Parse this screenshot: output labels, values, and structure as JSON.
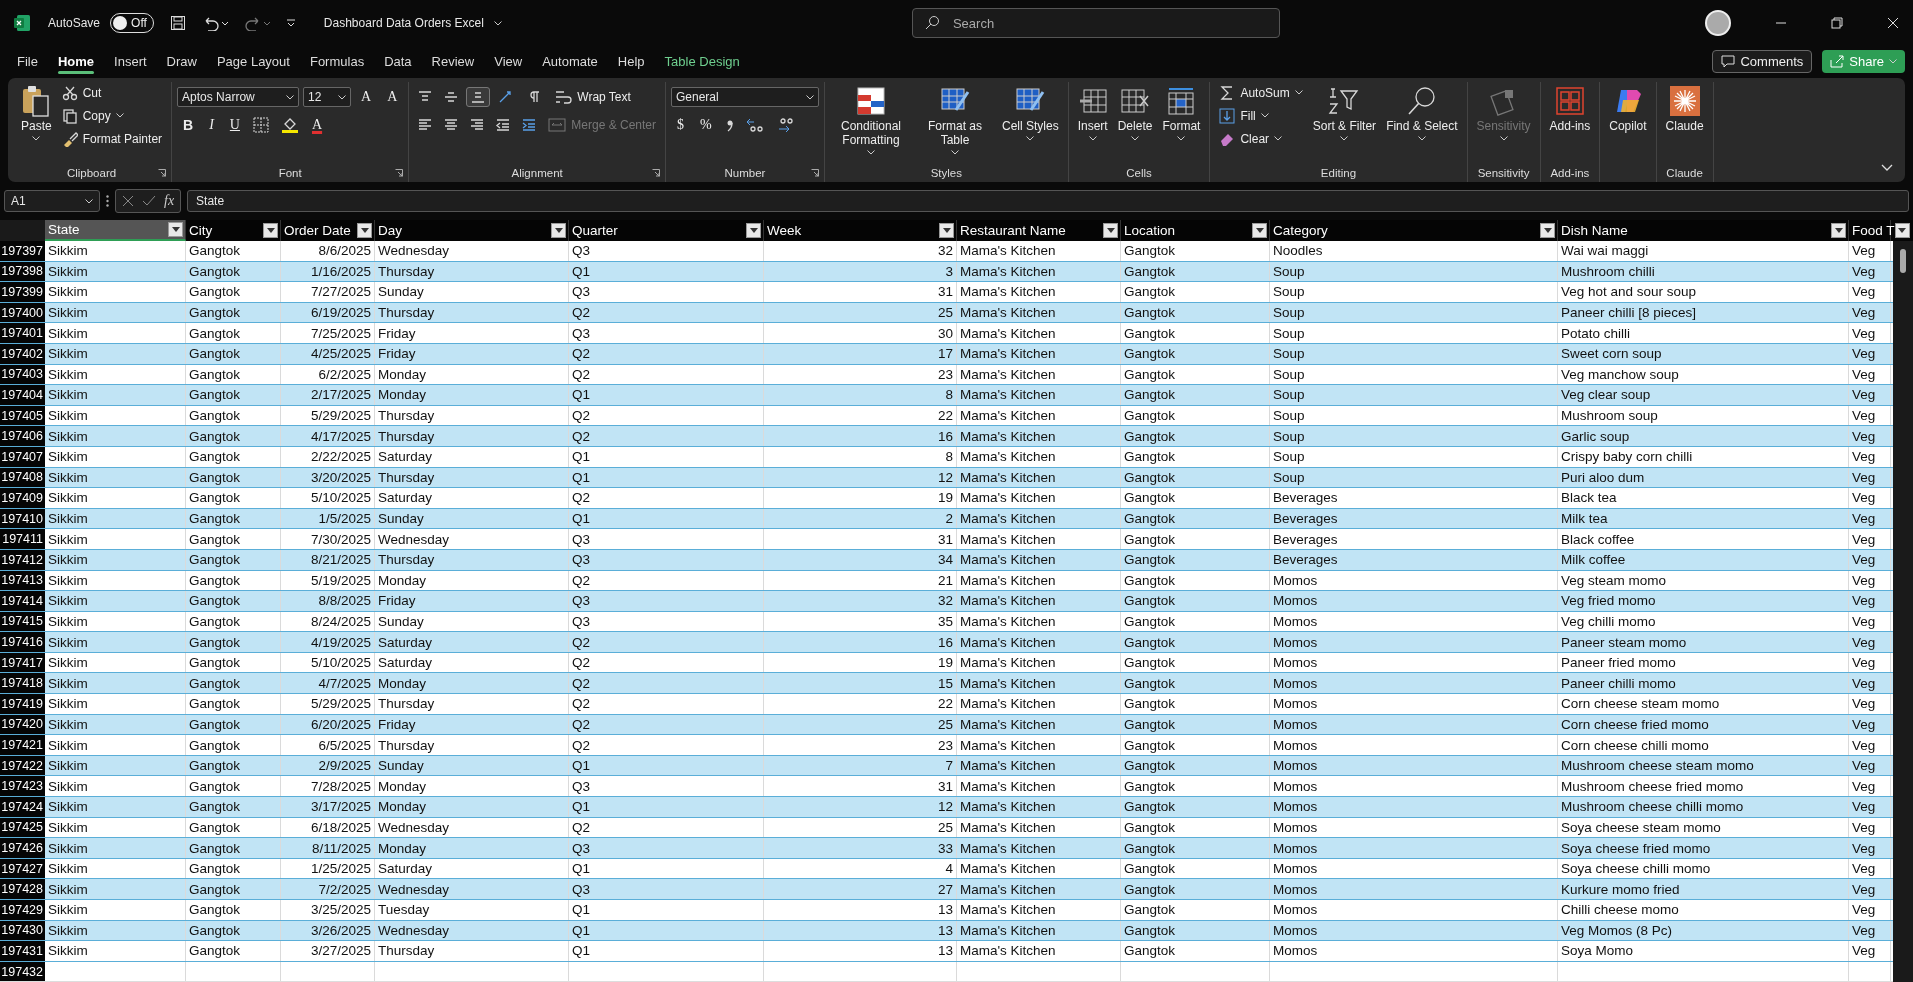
{
  "titlebar": {
    "autosave": {
      "label": "AutoSave",
      "on": false,
      "state_label": "Off"
    },
    "title": "Dashboard Data Orders Excel",
    "search": {
      "placeholder": "Search"
    }
  },
  "menu": {
    "tabs": [
      {
        "label": "File",
        "selected": false,
        "kind": "normal"
      },
      {
        "label": "Home",
        "selected": true,
        "kind": "normal"
      },
      {
        "label": "Insert",
        "selected": false,
        "kind": "normal"
      },
      {
        "label": "Draw",
        "selected": false,
        "kind": "normal"
      },
      {
        "label": "Page Layout",
        "selected": false,
        "kind": "normal"
      },
      {
        "label": "Formulas",
        "selected": false,
        "kind": "normal"
      },
      {
        "label": "Data",
        "selected": false,
        "kind": "normal"
      },
      {
        "label": "Review",
        "selected": false,
        "kind": "normal"
      },
      {
        "label": "View",
        "selected": false,
        "kind": "normal"
      },
      {
        "label": "Automate",
        "selected": false,
        "kind": "normal"
      },
      {
        "label": "Help",
        "selected": false,
        "kind": "normal"
      },
      {
        "label": "Table Design",
        "selected": false,
        "kind": "contextual"
      }
    ],
    "comments": "Comments",
    "share": "Share"
  },
  "ribbon": {
    "groups": [
      {
        "label": "Clipboard",
        "launcher": true,
        "items": [
          {
            "kind": "large",
            "label": "Paste",
            "caret": true,
            "disabled": false
          },
          {
            "kind": "small",
            "label": "Cut",
            "caret": false,
            "disabled": false
          },
          {
            "kind": "small",
            "label": "Copy",
            "caret": true,
            "disabled": false
          },
          {
            "kind": "small",
            "label": "Format Painter",
            "caret": false,
            "disabled": false
          }
        ]
      },
      {
        "label": "Font",
        "launcher": true,
        "top": [
          {
            "kind": "select",
            "value": "Aptos Narrow"
          },
          {
            "kind": "select",
            "value": "12"
          },
          {
            "kind": "glyph",
            "label": "A"
          },
          {
            "kind": "glyph",
            "label": "A"
          }
        ],
        "bottom": [
          {
            "kind": "glyph",
            "label": "B"
          },
          {
            "kind": "glyph",
            "label": "I"
          },
          {
            "kind": "glyph",
            "label": "U"
          },
          {
            "kind": "tool"
          },
          {
            "kind": "tool"
          },
          {
            "kind": "glyph",
            "label": "A"
          }
        ]
      },
      {
        "label": "Alignment",
        "launcher": true,
        "top": [
          {
            "kind": "tool"
          },
          {
            "kind": "tool"
          },
          {
            "kind": "tool"
          },
          {
            "kind": "tool"
          },
          {
            "kind": "tool"
          },
          {
            "kind": "small",
            "label": "Wrap Text",
            "disabled": false
          }
        ],
        "bottom": [
          {
            "kind": "tool"
          },
          {
            "kind": "tool"
          },
          {
            "kind": "tool"
          },
          {
            "kind": "tool"
          },
          {
            "kind": "tool"
          },
          {
            "kind": "small",
            "label": "Merge & Center",
            "disabled": true
          }
        ]
      },
      {
        "label": "Number",
        "launcher": true,
        "top": [
          {
            "kind": "select",
            "value": "General"
          }
        ],
        "bottom": [
          {
            "kind": "glyph",
            "label": "$"
          },
          {
            "kind": "glyph",
            "label": "%"
          },
          {
            "kind": "tool"
          },
          {
            "kind": "tool"
          },
          {
            "kind": "tool"
          }
        ]
      },
      {
        "label": "Styles",
        "launcher": false,
        "items": [
          {
            "kind": "large",
            "label": "Conditional Formatting",
            "caret": true,
            "disabled": false
          },
          {
            "kind": "large",
            "label": "Format as Table",
            "caret": true,
            "disabled": false
          },
          {
            "kind": "large",
            "label": "Cell Styles",
            "caret": true,
            "disabled": false
          }
        ]
      },
      {
        "label": "Cells",
        "launcher": false,
        "items": [
          {
            "kind": "large",
            "label": "Insert",
            "caret": true,
            "disabled": false
          },
          {
            "kind": "large",
            "label": "Delete",
            "caret": true,
            "disabled": false
          },
          {
            "kind": "large",
            "label": "Format",
            "caret": true,
            "disabled": false
          }
        ]
      },
      {
        "label": "Editing",
        "launcher": false,
        "items": [
          {
            "kind": "small",
            "label": "AutoSum",
            "caret": true,
            "disabled": false
          },
          {
            "kind": "small",
            "label": "Fill",
            "caret": true,
            "disabled": false
          },
          {
            "kind": "small",
            "label": "Clear",
            "caret": true,
            "disabled": false
          },
          {
            "kind": "large",
            "label": "Sort & Filter",
            "caret": true,
            "disabled": false
          },
          {
            "kind": "large",
            "label": "Find & Select",
            "caret": true,
            "disabled": false
          }
        ]
      },
      {
        "label": "Sensitivity",
        "launcher": false,
        "items": [
          {
            "kind": "large",
            "label": "Sensitivity",
            "caret": true,
            "disabled": true
          }
        ]
      },
      {
        "label": "Add-ins",
        "launcher": false,
        "items": [
          {
            "kind": "large",
            "label": "Add-ins",
            "caret": false,
            "disabled": false
          }
        ]
      },
      {
        "items": [
          {
            "kind": "large",
            "label": "Copilot",
            "caret": false,
            "disabled": false
          }
        ]
      },
      {
        "label": "Claude",
        "launcher": false,
        "items": [
          {
            "kind": "large",
            "label": "Claude",
            "caret": false,
            "disabled": false
          }
        ]
      }
    ]
  },
  "formula_bar": {
    "name_box": "A1",
    "fx": "fx",
    "value": "State"
  },
  "sheet": {
    "columns": [
      {
        "label": "State",
        "selected": true
      },
      {
        "label": "City",
        "selected": false
      },
      {
        "label": "Order Date",
        "selected": false
      },
      {
        "label": "Day",
        "selected": false
      },
      {
        "label": "Quarter",
        "selected": false
      },
      {
        "label": "Week",
        "selected": false
      },
      {
        "label": "Restaurant Name",
        "selected": false
      },
      {
        "label": "Location",
        "selected": false
      },
      {
        "label": "Category",
        "selected": false
      },
      {
        "label": "Dish Name",
        "selected": false
      },
      {
        "label": "Food T",
        "selected": false
      }
    ],
    "rows": [
      {
        "n": "197397",
        "cells": [
          "Sikkim",
          "Gangtok",
          "8/6/2025",
          "Wednesday",
          "Q3",
          "32",
          "Mama's Kitchen",
          "Gangtok",
          "Noodles",
          "Wai wai maggi",
          "Veg"
        ]
      },
      {
        "n": "197398",
        "cells": [
          "Sikkim",
          "Gangtok",
          "1/16/2025",
          "Thursday",
          "Q1",
          "3",
          "Mama's Kitchen",
          "Gangtok",
          "Soup",
          "Mushroom chilli",
          "Veg"
        ]
      },
      {
        "n": "197399",
        "cells": [
          "Sikkim",
          "Gangtok",
          "7/27/2025",
          "Sunday",
          "Q3",
          "31",
          "Mama's Kitchen",
          "Gangtok",
          "Soup",
          "Veg hot and sour soup",
          "Veg"
        ]
      },
      {
        "n": "197400",
        "cells": [
          "Sikkim",
          "Gangtok",
          "6/19/2025",
          "Thursday",
          "Q2",
          "25",
          "Mama's Kitchen",
          "Gangtok",
          "Soup",
          "Paneer chilli [8 pieces]",
          "Veg"
        ]
      },
      {
        "n": "197401",
        "cells": [
          "Sikkim",
          "Gangtok",
          "7/25/2025",
          "Friday",
          "Q3",
          "30",
          "Mama's Kitchen",
          "Gangtok",
          "Soup",
          "Potato chilli",
          "Veg"
        ]
      },
      {
        "n": "197402",
        "cells": [
          "Sikkim",
          "Gangtok",
          "4/25/2025",
          "Friday",
          "Q2",
          "17",
          "Mama's Kitchen",
          "Gangtok",
          "Soup",
          "Sweet corn soup",
          "Veg"
        ]
      },
      {
        "n": "197403",
        "cells": [
          "Sikkim",
          "Gangtok",
          "6/2/2025",
          "Monday",
          "Q2",
          "23",
          "Mama's Kitchen",
          "Gangtok",
          "Soup",
          "Veg manchow soup",
          "Veg"
        ]
      },
      {
        "n": "197404",
        "cells": [
          "Sikkim",
          "Gangtok",
          "2/17/2025",
          "Monday",
          "Q1",
          "8",
          "Mama's Kitchen",
          "Gangtok",
          "Soup",
          "Veg clear soup",
          "Veg"
        ]
      },
      {
        "n": "197405",
        "cells": [
          "Sikkim",
          "Gangtok",
          "5/29/2025",
          "Thursday",
          "Q2",
          "22",
          "Mama's Kitchen",
          "Gangtok",
          "Soup",
          "Mushroom soup",
          "Veg"
        ]
      },
      {
        "n": "197406",
        "cells": [
          "Sikkim",
          "Gangtok",
          "4/17/2025",
          "Thursday",
          "Q2",
          "16",
          "Mama's Kitchen",
          "Gangtok",
          "Soup",
          "Garlic soup",
          "Veg"
        ]
      },
      {
        "n": "197407",
        "cells": [
          "Sikkim",
          "Gangtok",
          "2/22/2025",
          "Saturday",
          "Q1",
          "8",
          "Mama's Kitchen",
          "Gangtok",
          "Soup",
          "Crispy baby corn chilli",
          "Veg"
        ]
      },
      {
        "n": "197408",
        "cells": [
          "Sikkim",
          "Gangtok",
          "3/20/2025",
          "Thursday",
          "Q1",
          "12",
          "Mama's Kitchen",
          "Gangtok",
          "Soup",
          "Puri aloo dum",
          "Veg"
        ]
      },
      {
        "n": "197409",
        "cells": [
          "Sikkim",
          "Gangtok",
          "5/10/2025",
          "Saturday",
          "Q2",
          "19",
          "Mama's Kitchen",
          "Gangtok",
          "Beverages",
          "Black tea",
          "Veg"
        ]
      },
      {
        "n": "197410",
        "cells": [
          "Sikkim",
          "Gangtok",
          "1/5/2025",
          "Sunday",
          "Q1",
          "2",
          "Mama's Kitchen",
          "Gangtok",
          "Beverages",
          "Milk tea",
          "Veg"
        ]
      },
      {
        "n": "197411",
        "cells": [
          "Sikkim",
          "Gangtok",
          "7/30/2025",
          "Wednesday",
          "Q3",
          "31",
          "Mama's Kitchen",
          "Gangtok",
          "Beverages",
          "Black coffee",
          "Veg"
        ]
      },
      {
        "n": "197412",
        "cells": [
          "Sikkim",
          "Gangtok",
          "8/21/2025",
          "Thursday",
          "Q3",
          "34",
          "Mama's Kitchen",
          "Gangtok",
          "Beverages",
          "Milk coffee",
          "Veg"
        ]
      },
      {
        "n": "197413",
        "cells": [
          "Sikkim",
          "Gangtok",
          "5/19/2025",
          "Monday",
          "Q2",
          "21",
          "Mama's Kitchen",
          "Gangtok",
          "Momos",
          "Veg steam momo",
          "Veg"
        ]
      },
      {
        "n": "197414",
        "cells": [
          "Sikkim",
          "Gangtok",
          "8/8/2025",
          "Friday",
          "Q3",
          "32",
          "Mama's Kitchen",
          "Gangtok",
          "Momos",
          "Veg fried momo",
          "Veg"
        ]
      },
      {
        "n": "197415",
        "cells": [
          "Sikkim",
          "Gangtok",
          "8/24/2025",
          "Sunday",
          "Q3",
          "35",
          "Mama's Kitchen",
          "Gangtok",
          "Momos",
          "Veg chilli momo",
          "Veg"
        ]
      },
      {
        "n": "197416",
        "cells": [
          "Sikkim",
          "Gangtok",
          "4/19/2025",
          "Saturday",
          "Q2",
          "16",
          "Mama's Kitchen",
          "Gangtok",
          "Momos",
          "Paneer steam momo",
          "Veg"
        ]
      },
      {
        "n": "197417",
        "cells": [
          "Sikkim",
          "Gangtok",
          "5/10/2025",
          "Saturday",
          "Q2",
          "19",
          "Mama's Kitchen",
          "Gangtok",
          "Momos",
          "Paneer fried momo",
          "Veg"
        ]
      },
      {
        "n": "197418",
        "cells": [
          "Sikkim",
          "Gangtok",
          "4/7/2025",
          "Monday",
          "Q2",
          "15",
          "Mama's Kitchen",
          "Gangtok",
          "Momos",
          "Paneer chilli momo",
          "Veg"
        ]
      },
      {
        "n": "197419",
        "cells": [
          "Sikkim",
          "Gangtok",
          "5/29/2025",
          "Thursday",
          "Q2",
          "22",
          "Mama's Kitchen",
          "Gangtok",
          "Momos",
          "Corn cheese steam momo",
          "Veg"
        ]
      },
      {
        "n": "197420",
        "cells": [
          "Sikkim",
          "Gangtok",
          "6/20/2025",
          "Friday",
          "Q2",
          "25",
          "Mama's Kitchen",
          "Gangtok",
          "Momos",
          "Corn cheese fried momo",
          "Veg"
        ]
      },
      {
        "n": "197421",
        "cells": [
          "Sikkim",
          "Gangtok",
          "6/5/2025",
          "Thursday",
          "Q2",
          "23",
          "Mama's Kitchen",
          "Gangtok",
          "Momos",
          "Corn cheese chilli momo",
          "Veg"
        ]
      },
      {
        "n": "197422",
        "cells": [
          "Sikkim",
          "Gangtok",
          "2/9/2025",
          "Sunday",
          "Q1",
          "7",
          "Mama's Kitchen",
          "Gangtok",
          "Momos",
          "Mushroom cheese steam momo",
          "Veg"
        ]
      },
      {
        "n": "197423",
        "cells": [
          "Sikkim",
          "Gangtok",
          "7/28/2025",
          "Monday",
          "Q3",
          "31",
          "Mama's Kitchen",
          "Gangtok",
          "Momos",
          "Mushroom cheese fried momo",
          "Veg"
        ]
      },
      {
        "n": "197424",
        "cells": [
          "Sikkim",
          "Gangtok",
          "3/17/2025",
          "Monday",
          "Q1",
          "12",
          "Mama's Kitchen",
          "Gangtok",
          "Momos",
          "Mushroom cheese chilli momo",
          "Veg"
        ]
      },
      {
        "n": "197425",
        "cells": [
          "Sikkim",
          "Gangtok",
          "6/18/2025",
          "Wednesday",
          "Q2",
          "25",
          "Mama's Kitchen",
          "Gangtok",
          "Momos",
          "Soya cheese steam momo",
          "Veg"
        ]
      },
      {
        "n": "197426",
        "cells": [
          "Sikkim",
          "Gangtok",
          "8/11/2025",
          "Monday",
          "Q3",
          "33",
          "Mama's Kitchen",
          "Gangtok",
          "Momos",
          "Soya cheese fried momo",
          "Veg"
        ]
      },
      {
        "n": "197427",
        "cells": [
          "Sikkim",
          "Gangtok",
          "1/25/2025",
          "Saturday",
          "Q1",
          "4",
          "Mama's Kitchen",
          "Gangtok",
          "Momos",
          "Soya cheese chilli momo",
          "Veg"
        ]
      },
      {
        "n": "197428",
        "cells": [
          "Sikkim",
          "Gangtok",
          "7/2/2025",
          "Wednesday",
          "Q3",
          "27",
          "Mama's Kitchen",
          "Gangtok",
          "Momos",
          "Kurkure momo fried",
          "Veg"
        ]
      },
      {
        "n": "197429",
        "cells": [
          "Sikkim",
          "Gangtok",
          "3/25/2025",
          "Tuesday",
          "Q1",
          "13",
          "Mama's Kitchen",
          "Gangtok",
          "Momos",
          "Chilli cheese momo",
          "Veg"
        ]
      },
      {
        "n": "197430",
        "cells": [
          "Sikkim",
          "Gangtok",
          "3/26/2025",
          "Wednesday",
          "Q1",
          "13",
          "Mama's Kitchen",
          "Gangtok",
          "Momos",
          "Veg Momos (8 Pc)",
          "Veg"
        ]
      },
      {
        "n": "197431",
        "cells": [
          "Sikkim",
          "Gangtok",
          "3/27/2025",
          "Thursday",
          "Q1",
          "13",
          "Mama's Kitchen",
          "Gangtok",
          "Momos",
          "Soya Momo",
          "Veg"
        ]
      },
      {
        "n": "197432",
        "cells": []
      }
    ]
  }
}
